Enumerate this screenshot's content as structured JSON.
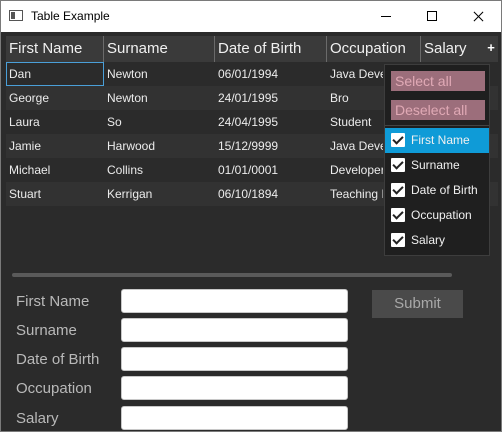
{
  "window": {
    "title": "Table Example"
  },
  "table": {
    "columns": [
      "First Name",
      "Surname",
      "Date of Birth",
      "Occupation",
      "Salary"
    ],
    "add_column_icon": "plus-icon",
    "rows": [
      [
        "Dan",
        "Newton",
        "06/01/1994",
        "Java Deve",
        ""
      ],
      [
        "George",
        "Newton",
        "24/01/1995",
        "Bro",
        ""
      ],
      [
        "Laura",
        "So",
        "24/04/1995",
        "Student",
        ""
      ],
      [
        "Jamie",
        "Harwood",
        "15/12/9999",
        "Java Deve",
        ""
      ],
      [
        "Michael",
        "Collins",
        "01/01/0001",
        "Developer",
        ""
      ],
      [
        "Stuart",
        "Kerrigan",
        "06/10/1894",
        "Teaching I",
        ""
      ]
    ]
  },
  "column_menu": {
    "select_all": "Select all",
    "deselect_all": "Deselect all",
    "items": [
      {
        "label": "First Name",
        "checked": true,
        "selected": true
      },
      {
        "label": "Surname",
        "checked": true,
        "selected": false
      },
      {
        "label": "Date of Birth",
        "checked": true,
        "selected": false
      },
      {
        "label": "Occupation",
        "checked": true,
        "selected": false
      },
      {
        "label": "Salary",
        "checked": true,
        "selected": false
      }
    ]
  },
  "form": {
    "labels": [
      "First Name",
      "Surname",
      "Date of Birth",
      "Occupation",
      "Salary"
    ],
    "values": [
      "",
      "",
      "",
      "",
      ""
    ],
    "submit_label": "Submit"
  },
  "colors": {
    "background": "#2b2b2b",
    "header": "#3a3a3a",
    "selected_item": "#0f9bd7",
    "menu_button": "#9c6e7b"
  }
}
